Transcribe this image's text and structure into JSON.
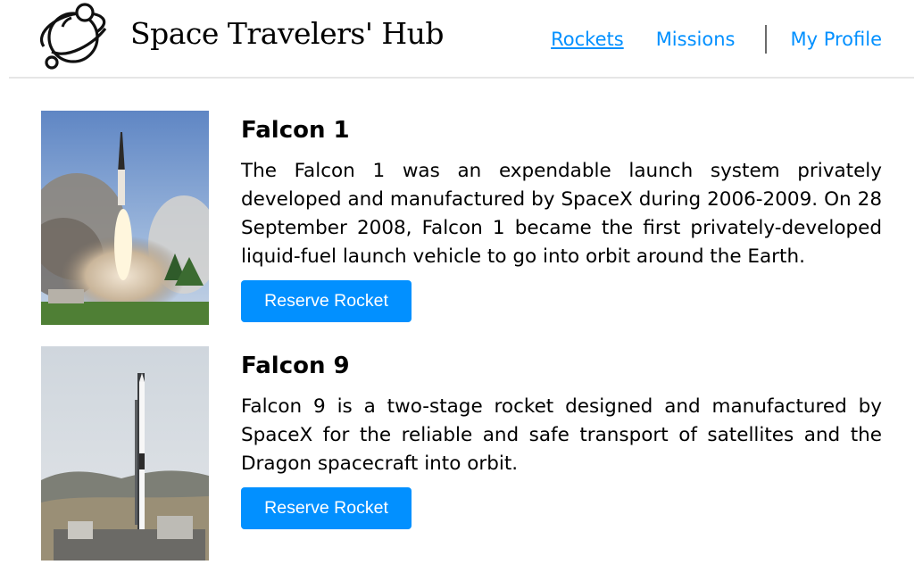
{
  "header": {
    "brand": "Space Travelers' Hub",
    "logo_icon": "planet-logo-icon",
    "nav": {
      "rockets": "Rockets",
      "missions": "Missions",
      "profile": "My Profile"
    },
    "colors": {
      "link": "#0290ff",
      "divider": "#6b6b6b"
    }
  },
  "rockets": [
    {
      "name": "Falcon 1",
      "description": "The Falcon 1 was an expendable launch system privately developed and manufactured by SpaceX during 2006-2009. On 28 September 2008, Falcon 1 became the first privately-developed liquid-fuel launch vehicle to go into orbit around the Earth.",
      "button_label": "Reserve Rocket",
      "image": "rocket-launch-photo"
    },
    {
      "name": "Falcon 9",
      "description": "Falcon 9 is a two-stage rocket designed and manufactured by SpaceX for the reliable and safe transport of satellites and the Dragon spacecraft into orbit.",
      "button_label": "Reserve Rocket",
      "image": "rocket-on-pad-photo"
    }
  ],
  "accent_color": "#0290ff"
}
